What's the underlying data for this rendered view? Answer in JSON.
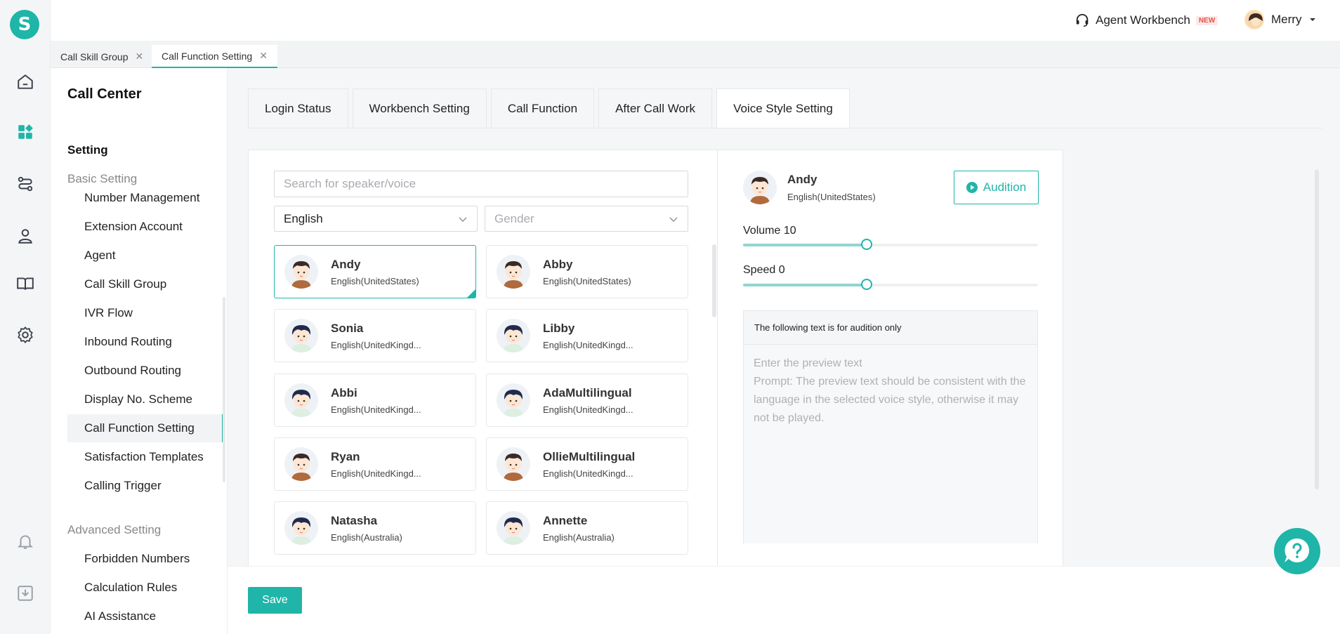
{
  "app": {
    "logo_letter": "S",
    "accent_color": "#1fb5a8"
  },
  "rail": {
    "icons": [
      "home-icon",
      "dashboard-icon",
      "routing-icon",
      "contacts-icon",
      "book-icon",
      "settings-icon",
      "bell-icon",
      "download-icon"
    ]
  },
  "topbar": {
    "workbench_label": "Agent Workbench",
    "new_badge": "NEW",
    "user_name": "Merry"
  },
  "page_tabs": [
    {
      "label": "Call Skill Group",
      "close": "✕"
    },
    {
      "label": "Call Function Setting",
      "close": "✕"
    }
  ],
  "sidebar": {
    "title": "Call Center",
    "section": "Setting",
    "basic_group": "Basic Setting",
    "basic_items": [
      "Number Management",
      "Extension Account",
      "Agent",
      "Call Skill Group",
      "IVR Flow",
      "Inbound Routing",
      "Outbound Routing",
      "Display No. Scheme",
      "Call Function Setting",
      "Satisfaction Templates",
      "Calling Trigger"
    ],
    "advanced_group": "Advanced Setting",
    "advanced_items": [
      "Forbidden Numbers",
      "Calculation Rules",
      "AI Assistance"
    ],
    "active_item": "Call Function Setting"
  },
  "tabs": [
    "Login Status",
    "Workbench Setting",
    "Call Function",
    "After Call Work",
    "Voice Style Setting"
  ],
  "active_tab": "Voice Style Setting",
  "filters": {
    "search_placeholder": "Search for speaker/voice",
    "language_value": "English",
    "gender_placeholder": "Gender"
  },
  "voices": [
    {
      "name": "Andy",
      "lang": "English(UnitedStates)",
      "selected": true,
      "gender": "male"
    },
    {
      "name": "Abby",
      "lang": "English(UnitedStates)",
      "selected": false,
      "gender": "male"
    },
    {
      "name": "Sonia",
      "lang": "English(UnitedKingd...",
      "selected": false,
      "gender": "female"
    },
    {
      "name": "Libby",
      "lang": "English(UnitedKingd...",
      "selected": false,
      "gender": "female"
    },
    {
      "name": "Abbi",
      "lang": "English(UnitedKingd...",
      "selected": false,
      "gender": "female"
    },
    {
      "name": "AdaMultilingual",
      "lang": "English(UnitedKingd...",
      "selected": false,
      "gender": "female"
    },
    {
      "name": "Ryan",
      "lang": "English(UnitedKingd...",
      "selected": false,
      "gender": "male"
    },
    {
      "name": "OllieMultilingual",
      "lang": "English(UnitedKingd...",
      "selected": false,
      "gender": "male"
    },
    {
      "name": "Natasha",
      "lang": "English(Australia)",
      "selected": false,
      "gender": "female"
    },
    {
      "name": "Annette",
      "lang": "English(Australia)",
      "selected": false,
      "gender": "female"
    }
  ],
  "preview": {
    "name": "Andy",
    "lang": "English(UnitedStates)",
    "audition_label": "Audition",
    "volume_label": "Volume 10",
    "volume_fraction": 0.42,
    "speed_label": "Speed 0",
    "speed_fraction": 0.42,
    "box_title": "The following text is for audition only",
    "text_placeholder": "Enter the preview text\nPrompt: The preview text should be consistent with the language in the selected voice style, otherwise it may not be played."
  },
  "footer": {
    "save_label": "Save"
  }
}
